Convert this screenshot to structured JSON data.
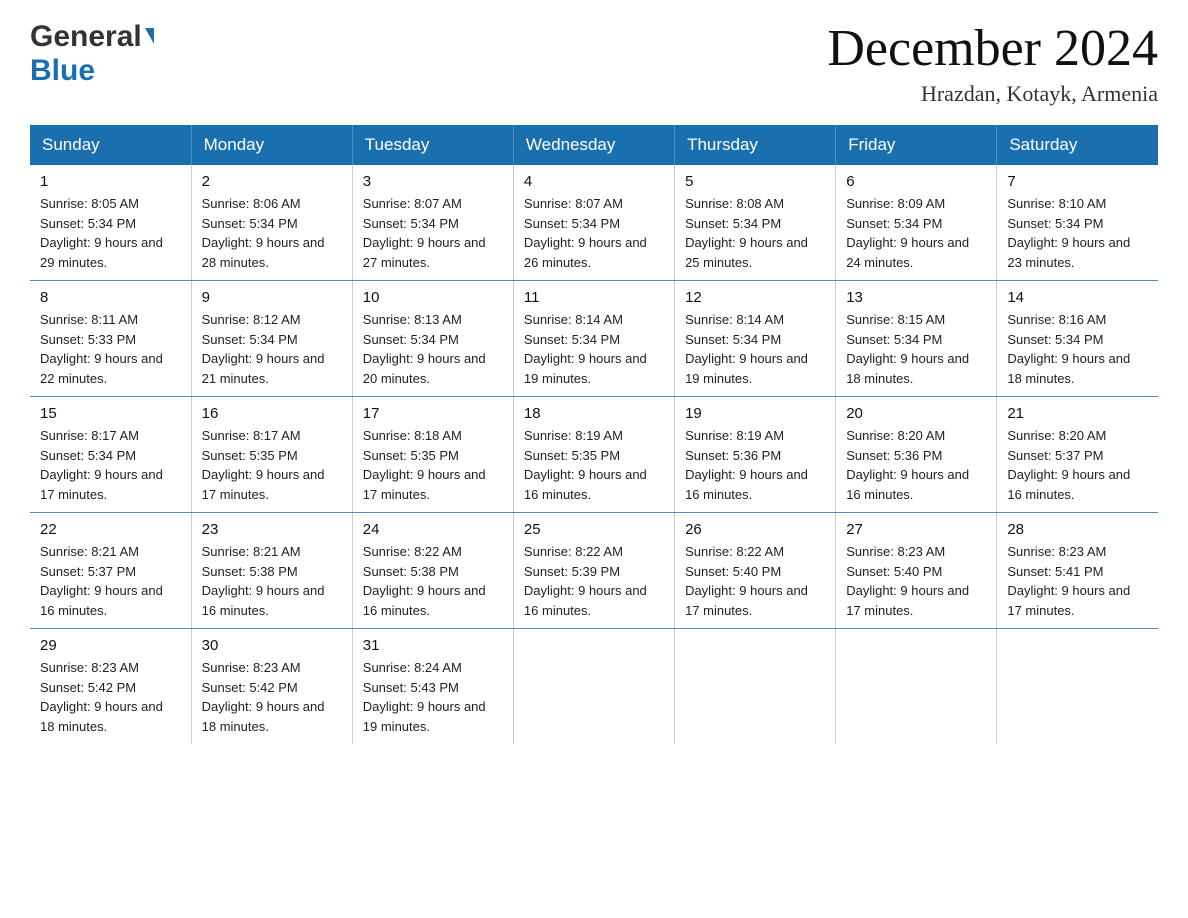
{
  "header": {
    "logo_general": "General",
    "logo_blue": "Blue",
    "month_title": "December 2024",
    "location": "Hrazdan, Kotayk, Armenia"
  },
  "calendar": {
    "days_of_week": [
      "Sunday",
      "Monday",
      "Tuesday",
      "Wednesday",
      "Thursday",
      "Friday",
      "Saturday"
    ],
    "weeks": [
      [
        {
          "day": "1",
          "sunrise": "Sunrise: 8:05 AM",
          "sunset": "Sunset: 5:34 PM",
          "daylight": "Daylight: 9 hours and 29 minutes."
        },
        {
          "day": "2",
          "sunrise": "Sunrise: 8:06 AM",
          "sunset": "Sunset: 5:34 PM",
          "daylight": "Daylight: 9 hours and 28 minutes."
        },
        {
          "day": "3",
          "sunrise": "Sunrise: 8:07 AM",
          "sunset": "Sunset: 5:34 PM",
          "daylight": "Daylight: 9 hours and 27 minutes."
        },
        {
          "day": "4",
          "sunrise": "Sunrise: 8:07 AM",
          "sunset": "Sunset: 5:34 PM",
          "daylight": "Daylight: 9 hours and 26 minutes."
        },
        {
          "day": "5",
          "sunrise": "Sunrise: 8:08 AM",
          "sunset": "Sunset: 5:34 PM",
          "daylight": "Daylight: 9 hours and 25 minutes."
        },
        {
          "day": "6",
          "sunrise": "Sunrise: 8:09 AM",
          "sunset": "Sunset: 5:34 PM",
          "daylight": "Daylight: 9 hours and 24 minutes."
        },
        {
          "day": "7",
          "sunrise": "Sunrise: 8:10 AM",
          "sunset": "Sunset: 5:34 PM",
          "daylight": "Daylight: 9 hours and 23 minutes."
        }
      ],
      [
        {
          "day": "8",
          "sunrise": "Sunrise: 8:11 AM",
          "sunset": "Sunset: 5:33 PM",
          "daylight": "Daylight: 9 hours and 22 minutes."
        },
        {
          "day": "9",
          "sunrise": "Sunrise: 8:12 AM",
          "sunset": "Sunset: 5:34 PM",
          "daylight": "Daylight: 9 hours and 21 minutes."
        },
        {
          "day": "10",
          "sunrise": "Sunrise: 8:13 AM",
          "sunset": "Sunset: 5:34 PM",
          "daylight": "Daylight: 9 hours and 20 minutes."
        },
        {
          "day": "11",
          "sunrise": "Sunrise: 8:14 AM",
          "sunset": "Sunset: 5:34 PM",
          "daylight": "Daylight: 9 hours and 19 minutes."
        },
        {
          "day": "12",
          "sunrise": "Sunrise: 8:14 AM",
          "sunset": "Sunset: 5:34 PM",
          "daylight": "Daylight: 9 hours and 19 minutes."
        },
        {
          "day": "13",
          "sunrise": "Sunrise: 8:15 AM",
          "sunset": "Sunset: 5:34 PM",
          "daylight": "Daylight: 9 hours and 18 minutes."
        },
        {
          "day": "14",
          "sunrise": "Sunrise: 8:16 AM",
          "sunset": "Sunset: 5:34 PM",
          "daylight": "Daylight: 9 hours and 18 minutes."
        }
      ],
      [
        {
          "day": "15",
          "sunrise": "Sunrise: 8:17 AM",
          "sunset": "Sunset: 5:34 PM",
          "daylight": "Daylight: 9 hours and 17 minutes."
        },
        {
          "day": "16",
          "sunrise": "Sunrise: 8:17 AM",
          "sunset": "Sunset: 5:35 PM",
          "daylight": "Daylight: 9 hours and 17 minutes."
        },
        {
          "day": "17",
          "sunrise": "Sunrise: 8:18 AM",
          "sunset": "Sunset: 5:35 PM",
          "daylight": "Daylight: 9 hours and 17 minutes."
        },
        {
          "day": "18",
          "sunrise": "Sunrise: 8:19 AM",
          "sunset": "Sunset: 5:35 PM",
          "daylight": "Daylight: 9 hours and 16 minutes."
        },
        {
          "day": "19",
          "sunrise": "Sunrise: 8:19 AM",
          "sunset": "Sunset: 5:36 PM",
          "daylight": "Daylight: 9 hours and 16 minutes."
        },
        {
          "day": "20",
          "sunrise": "Sunrise: 8:20 AM",
          "sunset": "Sunset: 5:36 PM",
          "daylight": "Daylight: 9 hours and 16 minutes."
        },
        {
          "day": "21",
          "sunrise": "Sunrise: 8:20 AM",
          "sunset": "Sunset: 5:37 PM",
          "daylight": "Daylight: 9 hours and 16 minutes."
        }
      ],
      [
        {
          "day": "22",
          "sunrise": "Sunrise: 8:21 AM",
          "sunset": "Sunset: 5:37 PM",
          "daylight": "Daylight: 9 hours and 16 minutes."
        },
        {
          "day": "23",
          "sunrise": "Sunrise: 8:21 AM",
          "sunset": "Sunset: 5:38 PM",
          "daylight": "Daylight: 9 hours and 16 minutes."
        },
        {
          "day": "24",
          "sunrise": "Sunrise: 8:22 AM",
          "sunset": "Sunset: 5:38 PM",
          "daylight": "Daylight: 9 hours and 16 minutes."
        },
        {
          "day": "25",
          "sunrise": "Sunrise: 8:22 AM",
          "sunset": "Sunset: 5:39 PM",
          "daylight": "Daylight: 9 hours and 16 minutes."
        },
        {
          "day": "26",
          "sunrise": "Sunrise: 8:22 AM",
          "sunset": "Sunset: 5:40 PM",
          "daylight": "Daylight: 9 hours and 17 minutes."
        },
        {
          "day": "27",
          "sunrise": "Sunrise: 8:23 AM",
          "sunset": "Sunset: 5:40 PM",
          "daylight": "Daylight: 9 hours and 17 minutes."
        },
        {
          "day": "28",
          "sunrise": "Sunrise: 8:23 AM",
          "sunset": "Sunset: 5:41 PM",
          "daylight": "Daylight: 9 hours and 17 minutes."
        }
      ],
      [
        {
          "day": "29",
          "sunrise": "Sunrise: 8:23 AM",
          "sunset": "Sunset: 5:42 PM",
          "daylight": "Daylight: 9 hours and 18 minutes."
        },
        {
          "day": "30",
          "sunrise": "Sunrise: 8:23 AM",
          "sunset": "Sunset: 5:42 PM",
          "daylight": "Daylight: 9 hours and 18 minutes."
        },
        {
          "day": "31",
          "sunrise": "Sunrise: 8:24 AM",
          "sunset": "Sunset: 5:43 PM",
          "daylight": "Daylight: 9 hours and 19 minutes."
        },
        null,
        null,
        null,
        null
      ]
    ]
  }
}
